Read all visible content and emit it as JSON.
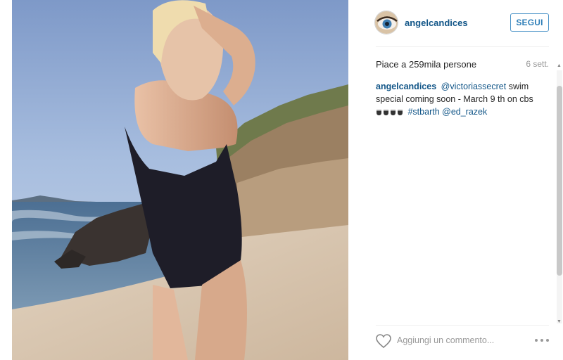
{
  "post": {
    "photo_icon": "photo",
    "username": "angelcandices",
    "follow_label": "SEGUI",
    "likes": "Piace a 259mila persone",
    "timestamp": "6 sett.",
    "caption": {
      "username": "angelcandices",
      "mention": "@victoriassecret",
      "text_1": " swim special coming soon - March 9 th on cbs ",
      "hashtag": "#stbarth",
      "mention_2": "@ed_razek"
    },
    "comment_placeholder": "Aggiungi un commento...",
    "icons": {
      "like": "heart-outline-icon",
      "more": "more-options-icon"
    }
  }
}
